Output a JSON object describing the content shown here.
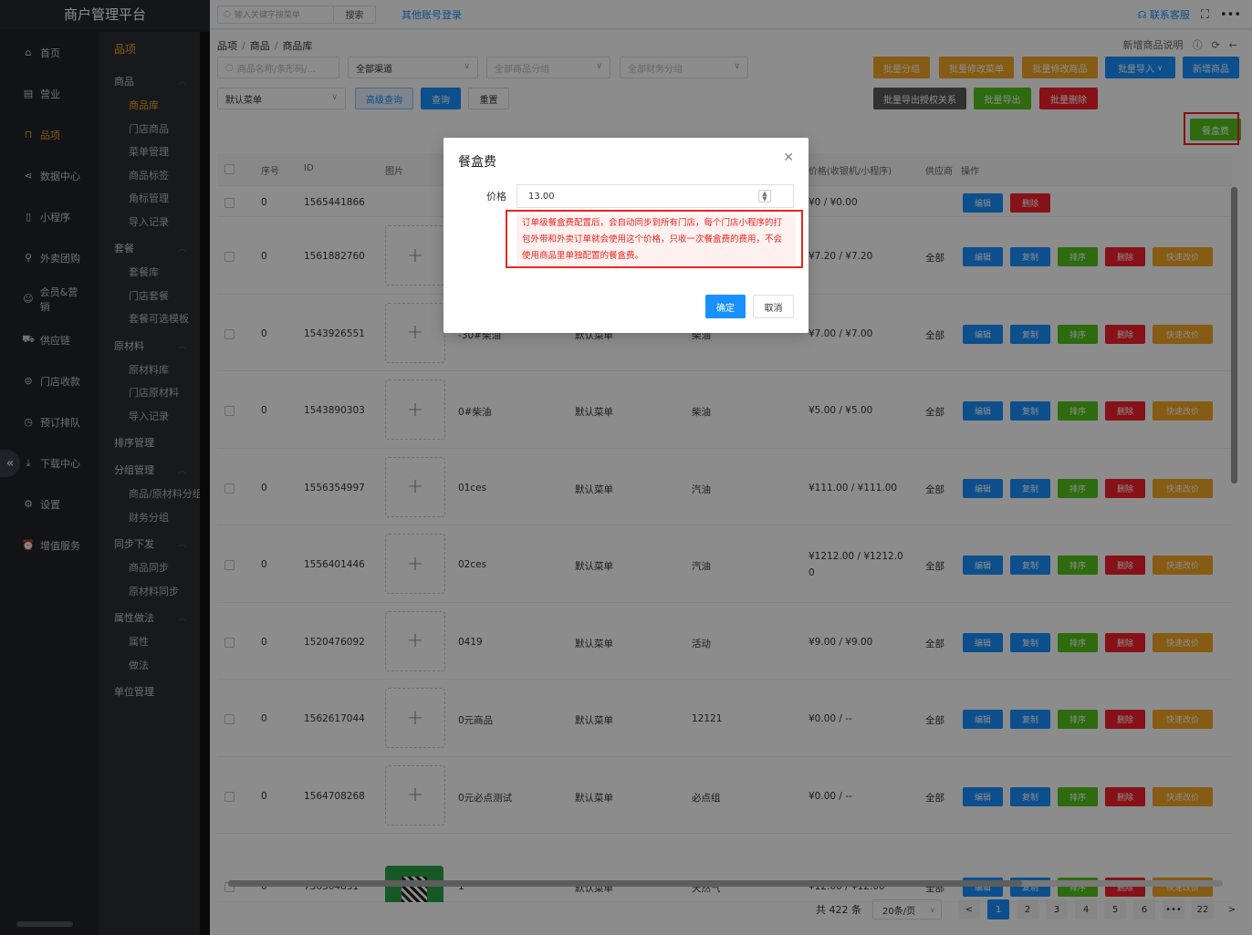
{
  "app_title": "商户管理平台",
  "topbar": {
    "search_placeholder": "输入关键字搜菜单",
    "search_button": "搜索",
    "other_login": "其他账号登录",
    "customer_service": "联系客服",
    "fullscreen_icon": "fullscreen-icon",
    "more_icon": "more-icon"
  },
  "main_nav": [
    {
      "label": "首页",
      "icon": "home-icon",
      "glyph": "⌂"
    },
    {
      "label": "营业",
      "icon": "shop-icon",
      "glyph": "▤"
    },
    {
      "label": "品项",
      "icon": "bag-icon",
      "glyph": "⊓",
      "active": true
    },
    {
      "label": "数据中心",
      "icon": "chart-icon",
      "glyph": "⋖"
    },
    {
      "label": "小程序",
      "icon": "phone-icon",
      "glyph": "▯"
    },
    {
      "label": "外卖团购",
      "icon": "bike-icon",
      "glyph": "⚲"
    },
    {
      "label": "会员&营销",
      "icon": "user-icon",
      "glyph": "☺"
    },
    {
      "label": "供应链",
      "icon": "truck-icon",
      "glyph": "⛟"
    },
    {
      "label": "门店收款",
      "icon": "wallet-icon",
      "glyph": "⊜"
    },
    {
      "label": "预订排队",
      "icon": "clock-icon",
      "glyph": "◷"
    },
    {
      "label": "下载中心",
      "icon": "download-icon",
      "glyph": "⤓"
    },
    {
      "label": "设置",
      "icon": "gear-icon",
      "glyph": "⚙"
    },
    {
      "label": "增值服务",
      "icon": "bell-icon",
      "glyph": "⏰"
    }
  ],
  "sub_nav": {
    "title": "品项",
    "groups": [
      {
        "label": "商品",
        "items": [
          "商品库",
          "门店商品",
          "菜单管理",
          "商品标签",
          "角标管理",
          "导入记录"
        ]
      },
      {
        "label": "套餐",
        "items": [
          "套餐库",
          "门店套餐",
          "套餐可选模板"
        ]
      },
      {
        "label": "原材料",
        "items": [
          "原材料库",
          "门店原材料",
          "导入记录"
        ]
      },
      {
        "label": "排序管理",
        "items": []
      },
      {
        "label": "分组管理",
        "items": [
          "商品/原材料分组",
          "财务分组"
        ]
      },
      {
        "label": "同步下发",
        "items": [
          "商品同步",
          "原材料同步"
        ]
      },
      {
        "label": "属性做法",
        "items": [
          "属性",
          "做法"
        ]
      },
      {
        "label": "单位管理",
        "items": []
      }
    ],
    "active_item": "商品库"
  },
  "breadcrumb": [
    "品项",
    "商品",
    "商品库"
  ],
  "help_text": "新增商品说明",
  "filters": {
    "name_placeholder": "商品名称/条形码/...",
    "channel": "全部渠道",
    "product_group_placeholder": "全部商品分组",
    "finance_group_placeholder": "全部财务分组",
    "menu": "默认菜单",
    "advanced_query": "高级查询",
    "query": "查询",
    "reset": "重置"
  },
  "action_buttons": {
    "batch_group": "批量分组",
    "batch_edit_menu": "批量修改菜单",
    "batch_edit_product": "批量修改商品",
    "batch_import": "批量导入",
    "add_product": "新增商品",
    "batch_export_auth": "批量导出授权关系",
    "batch_export": "批量导出",
    "batch_delete": "批量删除",
    "box_fee": "餐盒费"
  },
  "table": {
    "headers": [
      "序号",
      "ID",
      "图片",
      "价格(收银机/小程序)",
      "供应商",
      "操作"
    ],
    "rows": [
      {
        "seq": "0",
        "id": "1565441866",
        "name": "",
        "menu": "",
        "group": "",
        "price": "¥0 / ¥0.00",
        "supplier": "",
        "has_img": false,
        "short": true
      },
      {
        "seq": "0",
        "id": "1561882760",
        "name": "",
        "menu": "",
        "group": "",
        "price": "¥7.20 / ¥7.20",
        "supplier": "全部",
        "has_img": true
      },
      {
        "seq": "0",
        "id": "1543926551",
        "name": "-30#柴油",
        "menu": "默认菜单",
        "group": "柴油",
        "price": "¥7.00 / ¥7.00",
        "supplier": "全部",
        "has_img": true
      },
      {
        "seq": "0",
        "id": "1543890303",
        "name": "0#柴油",
        "menu": "默认菜单",
        "group": "柴油",
        "price": "¥5.00 / ¥5.00",
        "supplier": "全部",
        "has_img": true
      },
      {
        "seq": "0",
        "id": "1556354997",
        "name": "01ces",
        "menu": "默认菜单",
        "group": "汽油",
        "price": "¥111.00 / ¥111.00",
        "supplier": "全部",
        "has_img": true
      },
      {
        "seq": "0",
        "id": "1556401446",
        "name": "02ces",
        "menu": "默认菜单",
        "group": "汽油",
        "price": "¥1212.00 / ¥1212.0",
        "price2": "0",
        "supplier": "全部",
        "has_img": true
      },
      {
        "seq": "0",
        "id": "1520476092",
        "name": "0419",
        "menu": "默认菜单",
        "group": "活动",
        "price": "¥9.00 / ¥9.00",
        "supplier": "全部",
        "has_img": true
      },
      {
        "seq": "0",
        "id": "1562617044",
        "name": "0元商品",
        "menu": "默认菜单",
        "group": "12121",
        "price": "¥0.00 / --",
        "supplier": "全部",
        "has_img": true
      },
      {
        "seq": "0",
        "id": "1564708268",
        "name": "0元必点测试",
        "menu": "默认菜单",
        "group": "必点组",
        "price": "¥0.00 / --",
        "supplier": "全部",
        "has_img": true
      },
      {
        "seq": "0",
        "id": "736304831",
        "name": "1",
        "menu": "默认菜单",
        "group": "天然气",
        "price": "¥12.00 / ¥12.00",
        "supplier": "全部",
        "has_img": false,
        "qr": true
      }
    ],
    "ops": {
      "edit": "编辑",
      "copy": "复制",
      "sort": "排序",
      "delete": "删除",
      "quick_price": "快速改价"
    }
  },
  "pagination": {
    "total": "共 422 条",
    "page_size": "20条/页",
    "pages": [
      "1",
      "2",
      "3",
      "4",
      "5",
      "6",
      "•••",
      "22"
    ],
    "current": "1"
  },
  "modal": {
    "title": "餐盒费",
    "price_label": "价格",
    "price_value": "13.00",
    "note": "订单级餐盒费配置后，会自动同步到所有门店，每个门店小程序的打包外带和外卖订单就会使用这个价格，只收一次餐盒费的费用，不会使用商品里单独配置的餐盒费。",
    "confirm": "确定",
    "cancel": "取消"
  },
  "colors": {
    "accent": "#f5a623",
    "primary": "#1890ff",
    "success": "#52c41a",
    "danger": "#f5222d",
    "highlight": "#e8261e"
  }
}
